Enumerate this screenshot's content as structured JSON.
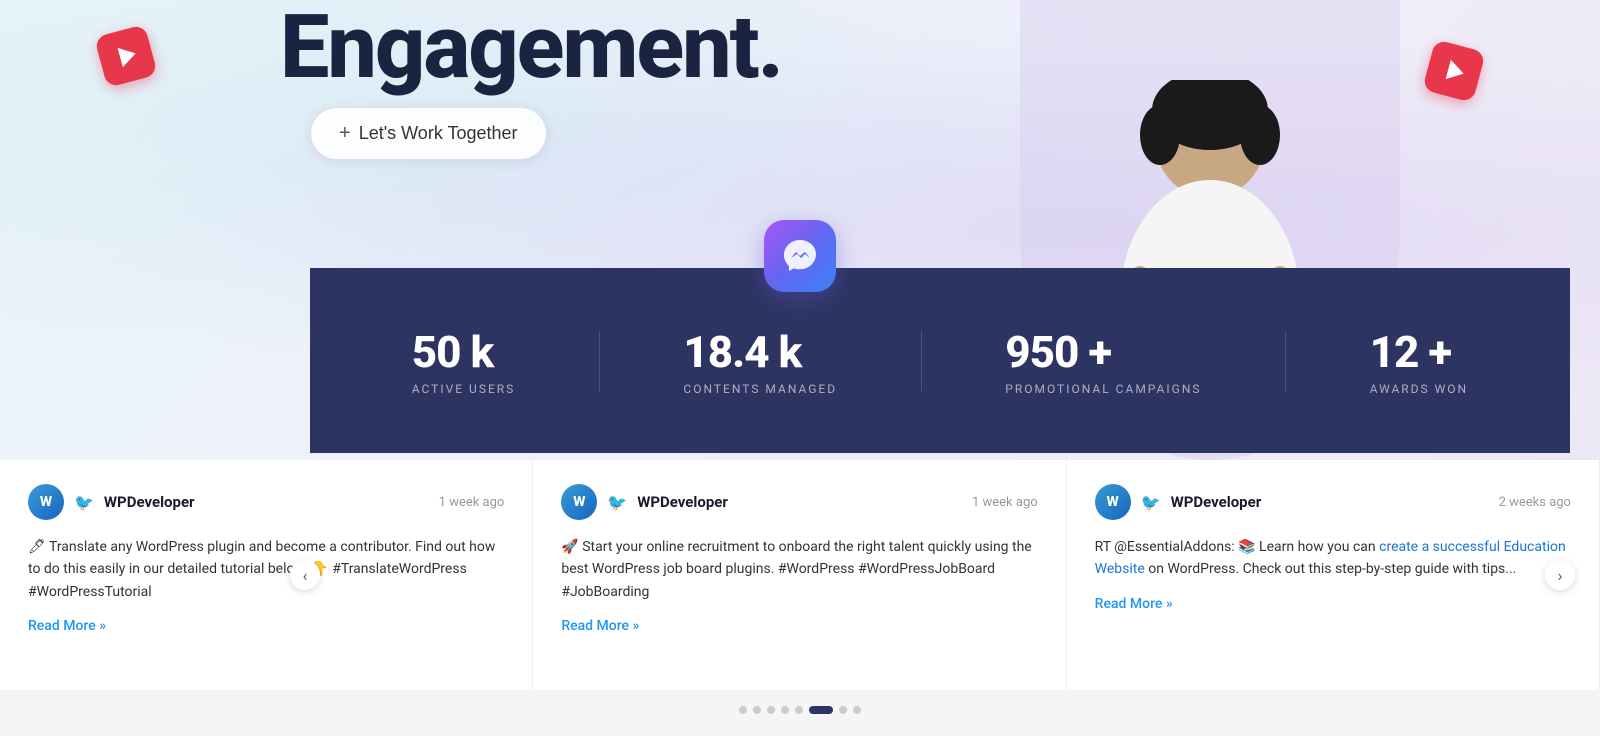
{
  "hero": {
    "title": "Engagement.",
    "cta_label": "Let's Work Together",
    "cta_prefix": "+"
  },
  "stats": [
    {
      "number": "50 k",
      "label": "ACTIVE USERS"
    },
    {
      "number": "18.4 k",
      "label": "CONTENTS MANAGED"
    },
    {
      "number": "950 +",
      "label": "PROMOTIONAL CAMPAIGNS"
    },
    {
      "number": "12 +",
      "label": "AWARDS WON"
    }
  ],
  "cards": [
    {
      "author": "WPDeveloper",
      "time": "1 week ago",
      "text": "🖊 Translate any WordPress plugin and become a contributor. Find out how to do this easily in our detailed tutorial below. 👇 #TranslateWordPress #WordPressTutorial",
      "read_more": "Read More »"
    },
    {
      "author": "WPDeveloper",
      "time": "1 week ago",
      "text": "🚀 Start your online recruitment to onboard the right talent quickly using the best WordPress job board plugins. #WordPress #WordPressJobBoard #JobBoarding",
      "read_more": "Read More »"
    },
    {
      "author": "WPDeveloper",
      "time": "2 weeks ago",
      "text": "RT @EssentialAddons: 📚 Learn how you can create a successful Education Website on WordPress. Check out this step-by-step guide with tips...",
      "read_more": "Read More »",
      "highlight_text": "create a successful Education Website"
    }
  ],
  "pagination": {
    "total_dots": 8,
    "active_index": 5
  }
}
